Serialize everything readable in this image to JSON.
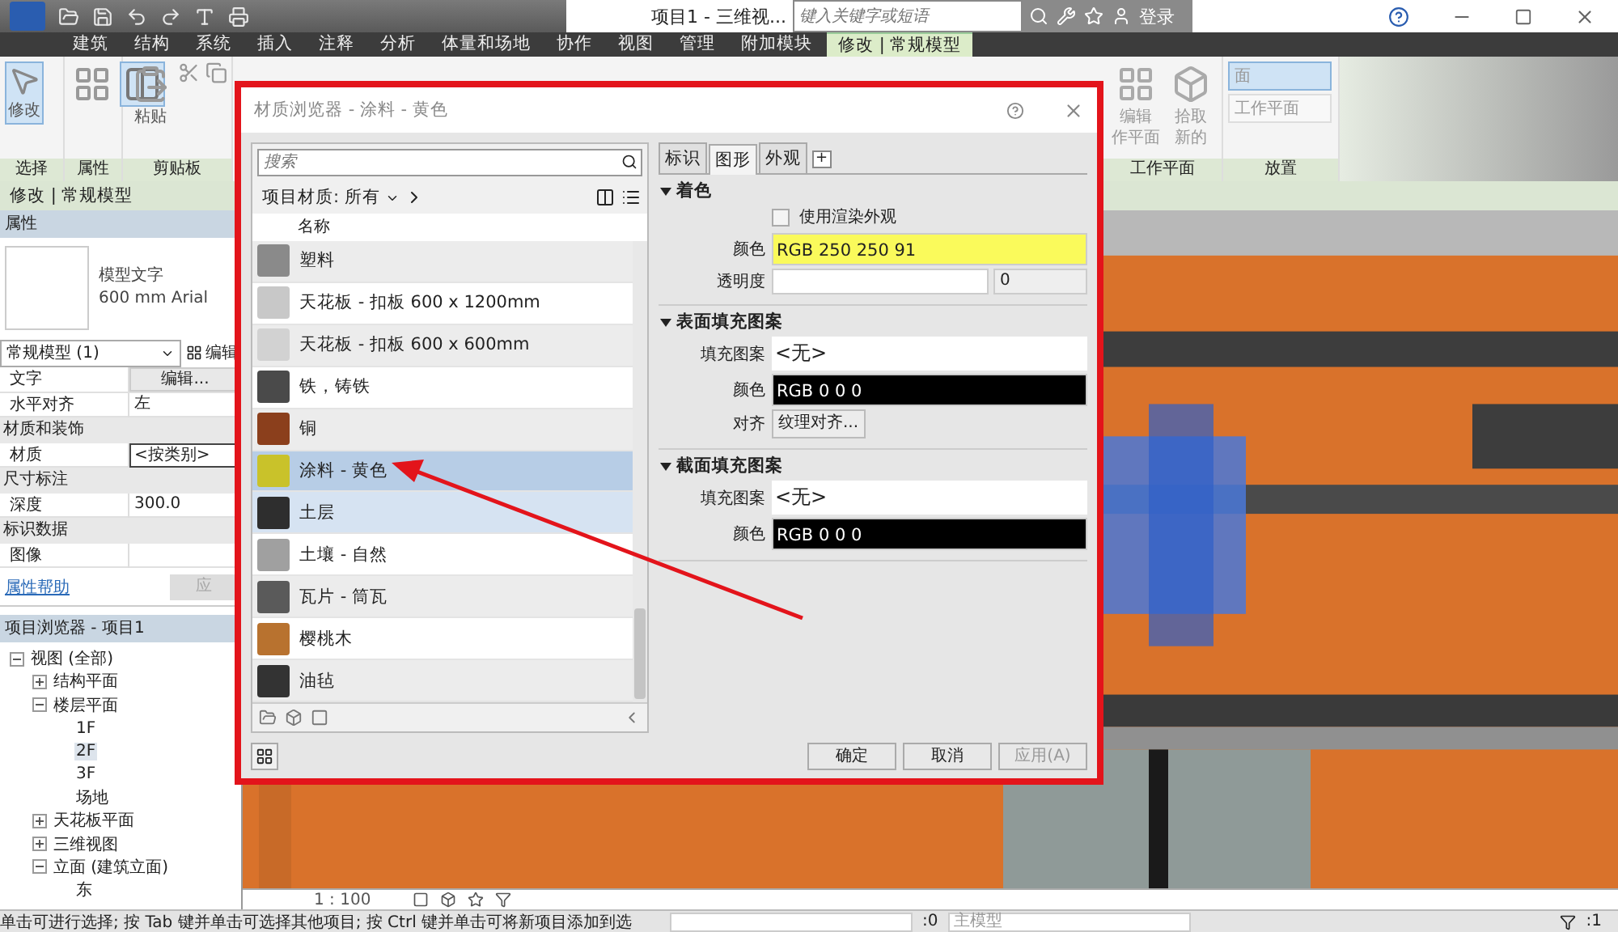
{
  "app_bar": {
    "title": "项目1 - 三维视...",
    "search": {
      "placeholder": "键入关键字或短语"
    },
    "login": "登录"
  },
  "ribbon_tabs": [
    {
      "label": "建筑",
      "selected": false
    },
    {
      "label": "结构",
      "selected": false
    },
    {
      "label": "系统",
      "selected": false
    },
    {
      "label": "插入",
      "selected": false
    },
    {
      "label": "注释",
      "selected": false
    },
    {
      "label": "分析",
      "selected": false
    },
    {
      "label": "体量和场地",
      "selected": false
    },
    {
      "label": "协作",
      "selected": false
    },
    {
      "label": "视图",
      "selected": false
    },
    {
      "label": "管理",
      "selected": false
    },
    {
      "label": "附加模块",
      "selected": false
    },
    {
      "label": "修改 | 常规模型",
      "selected": true
    }
  ],
  "ribbon_left": [
    {
      "title": "选择",
      "tools": [
        {
          "kind": "cursor",
          "label": "修改",
          "selected": true
        }
      ]
    },
    {
      "title": "属性",
      "tools": [
        {
          "kind": "types",
          "selected": false
        },
        {
          "kind": "props",
          "selected": true
        }
      ]
    },
    {
      "title": "剪贴板",
      "tools": [
        {
          "kind": "paste",
          "label": "粘贴",
          "selected": false
        }
      ]
    }
  ],
  "ribbon_right": [
    {
      "title": "工作平面",
      "tools": [
        {
          "kind": "grid",
          "lines": [
            "编辑",
            "作平面"
          ],
          "disabled": true
        },
        {
          "kind": "pick",
          "lines": [
            "拾取",
            "新的"
          ],
          "disabled": true
        }
      ]
    },
    {
      "title": "放置",
      "options": [
        {
          "label": "面",
          "selected": true
        },
        {
          "label": "工作平面",
          "selected": false
        }
      ]
    }
  ],
  "context_bar": "修改 | 常规模型",
  "properties": {
    "title": "属性",
    "type_name": "模型文字",
    "type_detail": "600 mm Arial",
    "selector": "常规模型 (1)",
    "edit_type": "编辑",
    "rows": [
      {
        "kind": "button",
        "label": "文字",
        "value": "编辑..."
      },
      {
        "kind": "text",
        "label": "水平对齐",
        "value": "左"
      },
      {
        "kind": "group",
        "label": "材质和装饰"
      },
      {
        "kind": "picker",
        "label": "材质",
        "value": "<按类别>"
      },
      {
        "kind": "group",
        "label": "尺寸标注"
      },
      {
        "kind": "text",
        "label": "深度",
        "value": "300.0"
      },
      {
        "kind": "group",
        "label": "标识数据"
      },
      {
        "kind": "text",
        "label": "图像"
      }
    ],
    "help_link": "属性帮助",
    "apply": "应"
  },
  "project_browser": {
    "title": "项目浏览器 - 项目1",
    "tree": [
      {
        "label": "视图 (全部)",
        "expanded": true,
        "selected": false,
        "children": [
          {
            "label": "结构平面",
            "expanded": false,
            "selected": false
          },
          {
            "label": "楼层平面",
            "expanded": true,
            "selected": false,
            "children": [
              {
                "label": "1F",
                "selected": false
              },
              {
                "label": "2F",
                "selected": true
              },
              {
                "label": "3F",
                "selected": false
              },
              {
                "label": "场地",
                "selected": false
              }
            ]
          },
          {
            "label": "天花板平面",
            "expanded": false,
            "selected": false
          },
          {
            "label": "三维视图",
            "expanded": false,
            "selected": false
          },
          {
            "label": "立面 (建筑立面)",
            "expanded": true,
            "selected": false,
            "children": [
              {
                "label": "东",
                "selected": false
              }
            ]
          }
        ]
      }
    ]
  },
  "view_bar": {
    "scale": "1 : 100"
  },
  "status_bar": {
    "message": "单击可进行选择; 按 Tab 键并单击可选择其他项目; 按 Ctrl 键并单击可将新项目添加到选",
    "count": ":0",
    "model": "主模型",
    "filter_count": ":1"
  },
  "material_browser": {
    "title": "材质浏览器 - 涂料 - 黄色",
    "search": {
      "placeholder": "搜索"
    },
    "filter": "项目材质: 所有",
    "column": "名称",
    "materials": [
      {
        "name": "塑料",
        "color": "#8a8a8a",
        "selected": false,
        "hovered": false
      },
      {
        "name": "天花板 - 扣板 600 x 1200mm",
        "color": "#c8c8c8",
        "selected": false,
        "hovered": false
      },
      {
        "name": "天花板 - 扣板 600 x 600mm",
        "color": "#d2d2d2",
        "selected": false,
        "hovered": false
      },
      {
        "name": "铁，铸铁",
        "color": "#4a4a4a",
        "selected": false,
        "hovered": false
      },
      {
        "name": "铜",
        "color": "#8b3f1c",
        "selected": false,
        "hovered": false
      },
      {
        "name": "涂料 - 黄色",
        "color": "#c9c22a",
        "selected": true,
        "hovered": false
      },
      {
        "name": "土层",
        "color": "#2e2e2e",
        "selected": false,
        "hovered": true
      },
      {
        "name": "土壤 - 自然",
        "color": "#a0a0a0",
        "selected": false,
        "hovered": false
      },
      {
        "name": "瓦片 - 筒瓦",
        "color": "#5a5a5a",
        "selected": false,
        "hovered": false
      },
      {
        "name": "樱桃木",
        "color": "#b8722f",
        "selected": false,
        "hovered": false
      },
      {
        "name": "油毡",
        "color": "#333333",
        "selected": false,
        "hovered": false
      }
    ],
    "tabs": [
      {
        "label": "标识",
        "selected": false
      },
      {
        "label": "图形",
        "selected": true
      },
      {
        "label": "外观",
        "selected": false
      }
    ],
    "add_tab": "+",
    "sections": [
      {
        "title": "着色",
        "expanded": true,
        "rows": [
          {
            "kind": "checkbox",
            "label": "使用渲染外观",
            "checked": false
          },
          {
            "kind": "swatch",
            "label": "颜色",
            "value": "RGB 250 250 91",
            "color": "#fafa5b"
          },
          {
            "kind": "slider",
            "label": "透明度",
            "value": "0"
          }
        ]
      },
      {
        "title": "表面填充图案",
        "expanded": true,
        "rows": [
          {
            "kind": "text",
            "label": "填充图案",
            "value": "<无>"
          },
          {
            "kind": "swatch",
            "label": "颜色",
            "value": "RGB 0 0 0",
            "color": "#000000"
          },
          {
            "kind": "button",
            "label": "对齐",
            "value": "纹理对齐..."
          }
        ]
      },
      {
        "title": "截面填充图案",
        "expanded": true,
        "rows": [
          {
            "kind": "text",
            "label": "填充图案",
            "value": "<无>"
          },
          {
            "kind": "swatch",
            "label": "颜色",
            "value": "RGB 0 0 0",
            "color": "#000000"
          }
        ]
      }
    ],
    "buttons": [
      {
        "label": "确定",
        "disabled": false
      },
      {
        "label": "取消",
        "disabled": false
      },
      {
        "label": "应用(A)",
        "disabled": true
      }
    ]
  }
}
